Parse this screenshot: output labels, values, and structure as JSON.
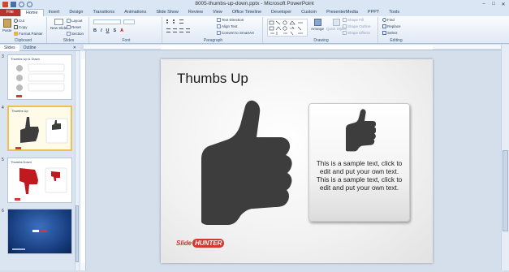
{
  "window": {
    "title": "8005-thumbs-up-down.pptx - Microsoft PowerPoint"
  },
  "tabs": [
    "File",
    "Home",
    "Insert",
    "Design",
    "Transitions",
    "Animations",
    "Slide Show",
    "Review",
    "View",
    "Office Timeline",
    "Developer",
    "Custom",
    "PresenterMedia",
    "PPPT",
    "Tools"
  ],
  "ribbon": {
    "clipboard": {
      "paste": "Paste",
      "cut": "Cut",
      "copy": "Copy",
      "format_painter": "Format Painter",
      "label": "Clipboard"
    },
    "slides": {
      "new_slide": "New Slide",
      "layout": "Layout",
      "reset": "Reset",
      "section": "Section",
      "label": "Slides"
    },
    "font": {
      "label": "Font"
    },
    "paragraph": {
      "text_direction": "Text Direction",
      "align_text": "Align Text",
      "convert_smartart": "Convert to SmartArt",
      "label": "Paragraph"
    },
    "drawing": {
      "arrange": "Arrange",
      "quick_styles": "Quick Styles",
      "shape_fill": "Shape Fill",
      "shape_outline": "Shape Outline",
      "shape_effects": "Shape Effects",
      "label": "Drawing"
    },
    "editing": {
      "find": "Find",
      "replace": "Replace",
      "select": "Select",
      "label": "Editing"
    }
  },
  "pane": {
    "tabs": [
      "Slides",
      "Outline"
    ],
    "slides": [
      {
        "number": "3",
        "title": "Thumbs Up & Down"
      },
      {
        "number": "4",
        "title": "Thumbs Up"
      },
      {
        "number": "5",
        "title": "Thumbs Down"
      },
      {
        "number": "6",
        "title": ""
      }
    ]
  },
  "slide": {
    "title": "Thumbs Up",
    "card_text": "This is a sample text, click to edit and put your own text. This is a sample text, click to edit and put your own text.",
    "logo_a": "Slide",
    "logo_b": "HUNTER"
  },
  "colors": {
    "accent": "#b9352c",
    "thumb": "#3d3d3d",
    "thumb_down": "#c0191f"
  }
}
